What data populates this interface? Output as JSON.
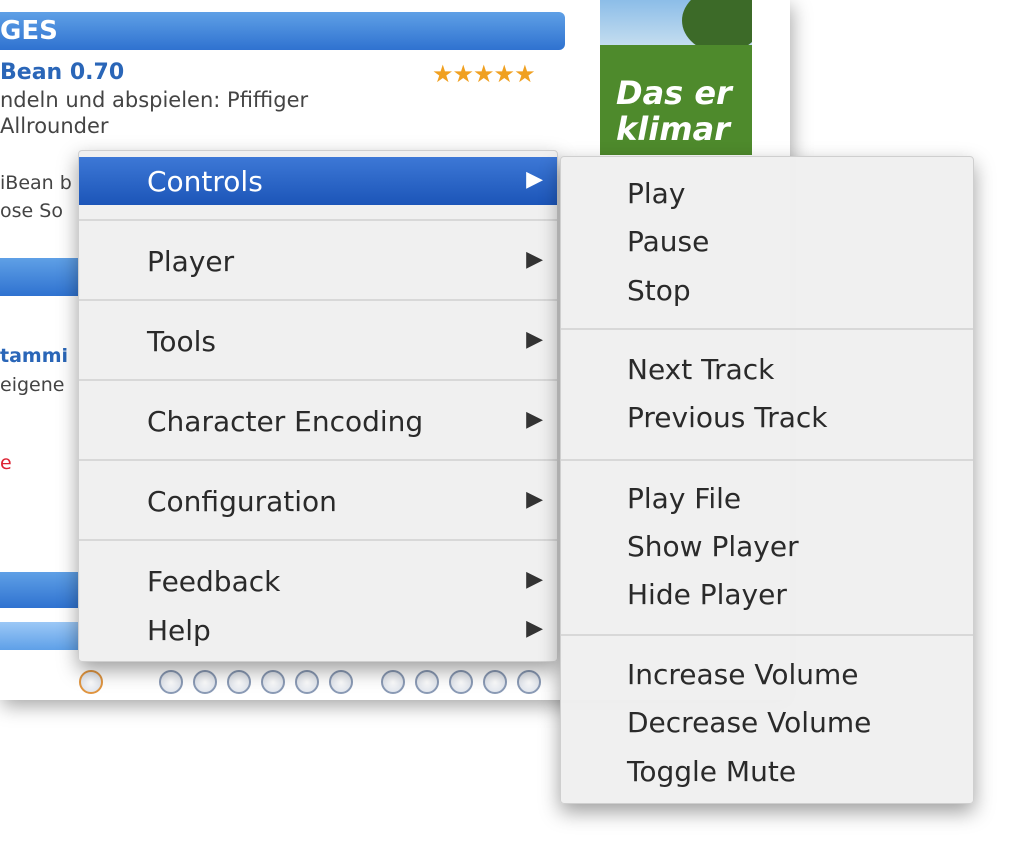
{
  "background": {
    "section_title": "GES",
    "item_title": "Bean 0.70",
    "rating": "★★★★★",
    "description_line1": "ndeln und abspielen: Pfiffiger",
    "description_line2": "Allrounder",
    "text_fragment1": "iBean b",
    "text_fragment2": "ose So",
    "text_fragment3": "tammi",
    "text_fragment4": "eigene",
    "text_fragment5": "e",
    "ad_line1": "Das er",
    "ad_line2": "klimar"
  },
  "main_menu": {
    "items": [
      {
        "label": "Controls",
        "submenu": true,
        "active": true
      },
      {
        "label": "Player",
        "submenu": true
      },
      {
        "label": "Tools",
        "submenu": true
      },
      {
        "label": "Character Encoding",
        "submenu": true
      },
      {
        "label": "Configuration",
        "submenu": true
      },
      {
        "label": "Feedback",
        "submenu": true
      },
      {
        "label": "Help",
        "submenu": true
      }
    ],
    "arrow_glyph": "▶"
  },
  "controls_submenu": {
    "items": [
      "Play",
      "Pause",
      "Stop",
      "Next Track",
      "Previous Track",
      "Play File",
      "Show Player",
      "Hide Player",
      "Increase Volume",
      "Decrease Volume",
      "Toggle Mute"
    ]
  },
  "colors": {
    "highlight": "#2a62c4",
    "section_bar": "#3a7ad6",
    "rating": "#f0a020"
  }
}
